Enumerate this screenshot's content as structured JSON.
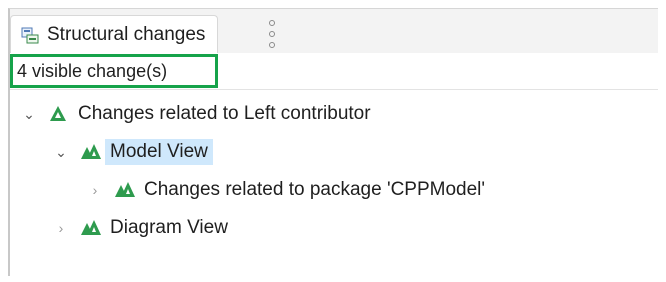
{
  "view": {
    "tab_title": "Structural changes",
    "status_text": "4 visible change(s)"
  },
  "tree": [
    {
      "label": "Changes related to Left contributor",
      "expanded": true,
      "level": 0,
      "selected": false
    },
    {
      "label": "Model View",
      "expanded": true,
      "level": 1,
      "selected": true
    },
    {
      "label": "Changes related to package 'CPPModel'",
      "expanded": false,
      "level": 2,
      "selected": false
    },
    {
      "label": "Diagram View",
      "expanded": false,
      "level": 1,
      "selected": false
    }
  ],
  "colors": {
    "accent": "#16a34a",
    "selection": "#cfe8fc",
    "triangle": "#2e9b4e"
  },
  "icons": {
    "tab": "structure-view-icon",
    "tree_node": "change-triangle-icon"
  }
}
